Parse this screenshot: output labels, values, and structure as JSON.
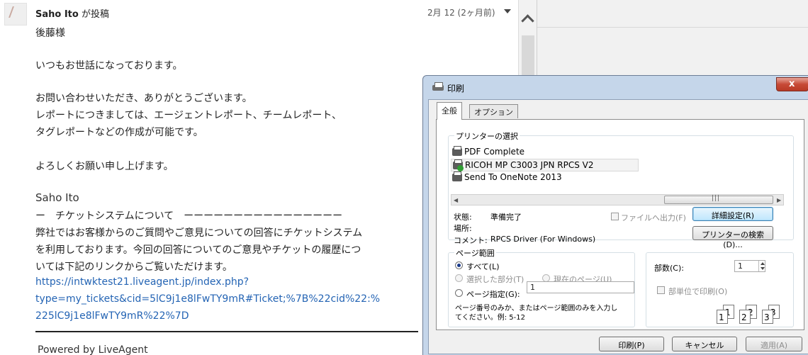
{
  "email": {
    "sender_name": "Saho Ito",
    "sender_suffix": " が投稿",
    "date": "2月 12 (2ヶ月前)",
    "lines": {
      "greeting": "後藤様",
      "l1": "いつもお世話になっております。",
      "l2": "お問い合わせいただき、ありがとうございます。",
      "l3": "レポートにつきましては、エージェントレポート、チームレポート、",
      "l4": "タグレポートなどの作成が可能です。",
      "l5": "よろしくお願い申し上げます。",
      "signature": "Saho Ito",
      "section_head": "ー　チケットシステムについて　ーーーーーーーーーーーーーーーー",
      "b1": "弊社ではお客様からのご質問やご意見についての回答にチケットシステム",
      "b2": "を利用しております。今回の回答についてのご意見やチケットの履歴につ",
      "b3": "いては下記のリンクからご覧いただけます。",
      "link1": "https://intwktest21.liveagent.jp/index.php?",
      "link2": "type=my_tickets&cid=5lC9j1e8lFwTY9mR#Ticket;%7B%22cid%22:%",
      "link3": "225lC9j1e8lFwTY9mR%22%7D",
      "powered": "Powered by LiveAgent"
    }
  },
  "dialog": {
    "title": "印刷",
    "tabs": [
      "全般",
      "オプション"
    ],
    "printer_group_label": "プリンターの選択",
    "printers": [
      "PDF Complete",
      "RICOH MP C3003 JPN RPCS V2",
      "Send To OneNote 2013"
    ],
    "status_label": "状態:",
    "status_value": "準備完了",
    "location_label": "場所:",
    "comment_label": "コメント:",
    "comment_value": "RPCS Driver (For Windows)",
    "print_to_file": "ファイルへ出力(F)",
    "advanced_button": "詳細設定(R)",
    "find_printer_button": "プリンターの検索(D)...",
    "range_group_label": "ページ範囲",
    "range_all": "すべて(L)",
    "range_selection": "選択した部分(T)",
    "range_current": "現在のページ(U)",
    "range_pages": "ページ指定(G):",
    "range_pages_value": "1",
    "range_hint_1": "ページ番号のみか、またはページ範囲のみを入力し",
    "range_hint_2": "てください。例: 5-12",
    "copies_label": "部数(C):",
    "copies_value": "1",
    "collate": "部単位で印刷(O)",
    "collate_pages": [
      "1",
      "1",
      "2",
      "2",
      "3",
      "3"
    ],
    "print_button": "印刷(P)",
    "cancel_button": "キャンセル",
    "apply_button": "適用(A)",
    "close_glyph": "x"
  }
}
